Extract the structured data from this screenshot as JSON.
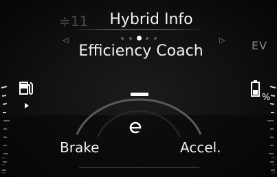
{
  "screen": {
    "page_indicator": "≑11",
    "title": "Hybrid Info",
    "subtitle": "Efficiency Coach",
    "ev_label": "EV",
    "left_label": "Brake",
    "right_label": "Accel.",
    "arrow_left": "◁",
    "arrow_right": "▷"
  },
  "pagination": {
    "total": 5,
    "active_index": 2
  },
  "icons": {
    "fuel": "fuel-pump-icon",
    "battery": "battery-percent-icon",
    "eco": "eco-indicator-icon"
  },
  "colors": {
    "text": "#f2f2f2",
    "dim": "#8a8a8a",
    "background": "#0a0a0a"
  }
}
